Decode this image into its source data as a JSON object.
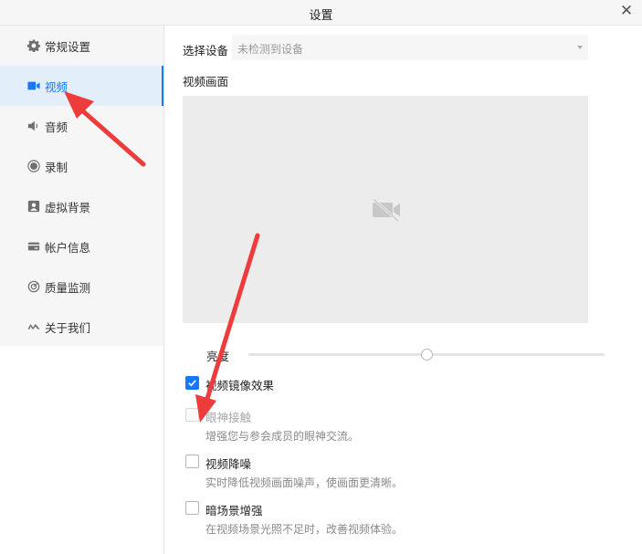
{
  "window": {
    "title": "设置"
  },
  "sidebar": {
    "items": [
      {
        "label": "常规设置",
        "icon": "gear-icon",
        "active": false
      },
      {
        "label": "视频",
        "icon": "video-camera-icon",
        "active": true
      },
      {
        "label": "音频",
        "icon": "speaker-icon",
        "active": false
      },
      {
        "label": "录制",
        "icon": "record-icon",
        "active": false
      },
      {
        "label": "虚拟背景",
        "icon": "portrait-icon",
        "active": false
      },
      {
        "label": "帐户信息",
        "icon": "card-icon",
        "active": false
      },
      {
        "label": "质量监测",
        "icon": "gauge-icon",
        "active": false
      },
      {
        "label": "关于我们",
        "icon": "logo-icon",
        "active": false
      }
    ]
  },
  "video": {
    "device_label": "选择设备",
    "device_value": "未检测到设备",
    "preview_label": "视频画面",
    "brightness_label": "亮度",
    "brightness_level": 0.5,
    "options": [
      {
        "label": "视频镜像效果",
        "desc": "",
        "checked": true,
        "disabled": false
      },
      {
        "label": "眼神接触",
        "desc": "增强您与参会成员的眼神交流。",
        "checked": false,
        "disabled": true
      },
      {
        "label": "视频降噪",
        "desc": "实时降低视频画面噪声，使画面更清晰。",
        "checked": false,
        "disabled": false
      },
      {
        "label": "暗场景增强",
        "desc": "在视频场景光照不足时，改善视频体验。",
        "checked": false,
        "disabled": false
      }
    ]
  },
  "colors": {
    "accent": "#1677ff",
    "annotation_arrow": "#ee3b3b"
  }
}
